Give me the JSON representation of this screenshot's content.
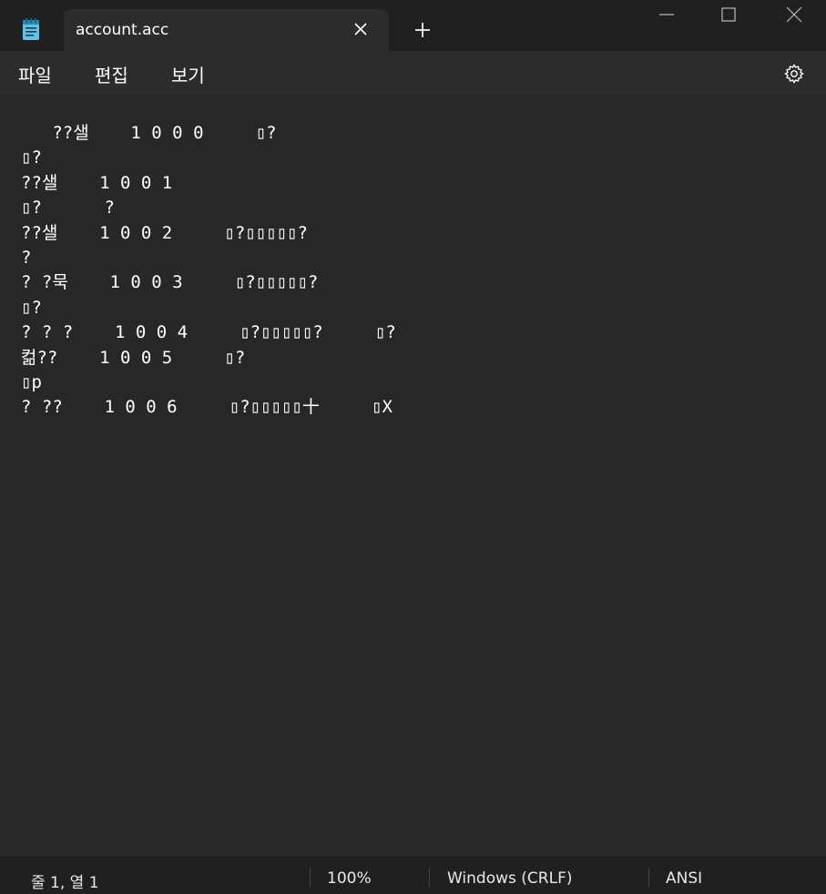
{
  "tab": {
    "title": "account.acc",
    "close_icon": "close-icon",
    "new_tab_icon": "plus-icon"
  },
  "app": {
    "icon": "notepad-icon"
  },
  "window_controls": {
    "minimize_icon": "minimize-icon",
    "maximize_icon": "maximize-icon",
    "close_icon": "close-icon"
  },
  "menu": {
    "file": "파일",
    "edit": "편집",
    "view": "보기",
    "settings_icon": "gear-icon"
  },
  "document": {
    "content": "   ??샐    1 0 0 0     ▯?\n▯?\n??샐    1 0 0 1\n▯?      ?\n??샐    1 0 0 2     ▯?▯▯▯▯▯?\n?\n? ?묵    1 0 0 3     ▯?▯▯▯▯▯?\n▯?\n? ? ?    1 0 0 4     ▯?▯▯▯▯▯?     ▯?\n컮??    1 0 0 5     ▯?\n▯p\n? ??    1 0 0 6     ▯?▯▯▯▯▯十     ▯X"
  },
  "status": {
    "position": "줄 1, 열 1",
    "zoom": "100%",
    "line_ending": "Windows (CRLF)",
    "encoding": "ANSI"
  },
  "colors": {
    "titlebar": "#202020",
    "tab": "#2c2c2c",
    "editor": "#272727",
    "statusbar": "#202020"
  }
}
